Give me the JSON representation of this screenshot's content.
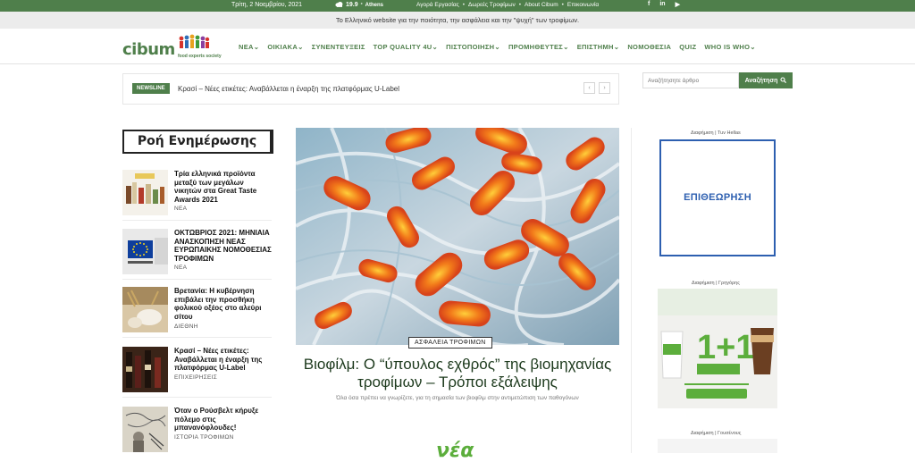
{
  "topbar": {
    "date": "Τρίτη, 2 Νοεμβρίου, 2021",
    "temp": "19.9",
    "deg": "°",
    "city": "Athens",
    "links": [
      "Αγορά Εργασίας",
      "Δωρεές Τροφίμων",
      "About Cibum",
      "Επικοινωνία"
    ],
    "social": [
      "f",
      "in",
      "▶"
    ]
  },
  "tagline": "Το Ελληνικό website για την ποιότητα, την ασφάλεια και την \"ψυχή\" των τροφίμων.",
  "logo": {
    "word": "cibum",
    "sub": "food experts society"
  },
  "nav": [
    "ΝΕΑ⌄",
    "ΟΙΚΙΑΚΑ⌄",
    "ΣΥΝΕΝΤΕΥΞΕΙΣ",
    "TOP QUALITY 4U⌄",
    "ΠΙΣΤΟΠΟΙΗΣΗ⌄",
    "ΠΡΟΜΗΘΕΥΤΕΣ⌄",
    "ΕΠΙΣΤΗΜΗ⌄",
    "ΝΟΜΟΘΕΣΙΑ",
    "QUIZ",
    "WHO IS WHO⌄"
  ],
  "newsline": {
    "badge": "NEWSLINE",
    "text": "Κρασί – Νέες ετικέτες: Αναβάλλεται η έναρξη της πλατφόρμας U-Label",
    "prev": "‹",
    "next": "›"
  },
  "search": {
    "placeholder": "Αναζήτησητε άρθρο",
    "button": "Αναζήτηση"
  },
  "feed": {
    "title": "Ροή Ενημέρωσης",
    "items": [
      {
        "title": "Τρία ελληνικά προϊόντα μεταξύ των μεγάλων νικητών στα Great Taste Awards 2021",
        "cat": "ΝΕΑ"
      },
      {
        "title": "ΟΚΤΩΒΡΙΟΣ 2021: ΜΗΝΙΑΙΑ ΑΝΑΣΚΟΠΗΣΗ ΝΕΑΣ ΕΥΡΩΠΑΙΚΗΣ ΝΟΜΟΘΕΣΙΑΣ ΤΡΟΦΙΜΩΝ",
        "cat": "ΝΕΑ"
      },
      {
        "title": "Βρετανία: Η κυβέρνηση επιβάλει την προσθήκη φολικού οξέος στο αλεύρι σίτου",
        "cat": "ΔΙΕΘΝΗ"
      },
      {
        "title": "Κρασί – Νέες ετικέτες: Αναβάλλεται η έναρξη της πλατφόρμας U-Label",
        "cat": "ΕΠΙΧΕΙΡΗΣΕΙΣ"
      },
      {
        "title": "Όταν ο Ρούσβελτ κήρυξε πόλεμο στις μπανανόφλουδες!",
        "cat": "ΙΣΤΟΡΙΑ ΤΡΟΦΙΜΩΝ"
      }
    ]
  },
  "hero": {
    "category": "ΑΣΦΑΛΕΙΑ ΤΡΟΦΙΜΩΝ",
    "title": "Βιοφίλμ: Ο “ύπουλος εχθρός” της βιομηχανίας τροφίμων – Τρόποι εξάλειψης",
    "subtitle": "Όλα όσα πρέπει να γνωρίζετε, για τη σημασία των βιοφίλμ στην αντιμετώπιση των παθογόνων"
  },
  "nea_logo": "νέα",
  "ads": {
    "label1": "Διαφήμιση | Tuv Hellas",
    "ad1_text": "ΕΠΙΘΕΩΡΗΣΗ",
    "label2": "Διαφήμιση | Γρηγόρης",
    "label3": "Διαφήμιση | Γουσένους"
  },
  "colors": {
    "brand_green": "#4f7f4b",
    "ad_blue": "#2d5fb0"
  }
}
